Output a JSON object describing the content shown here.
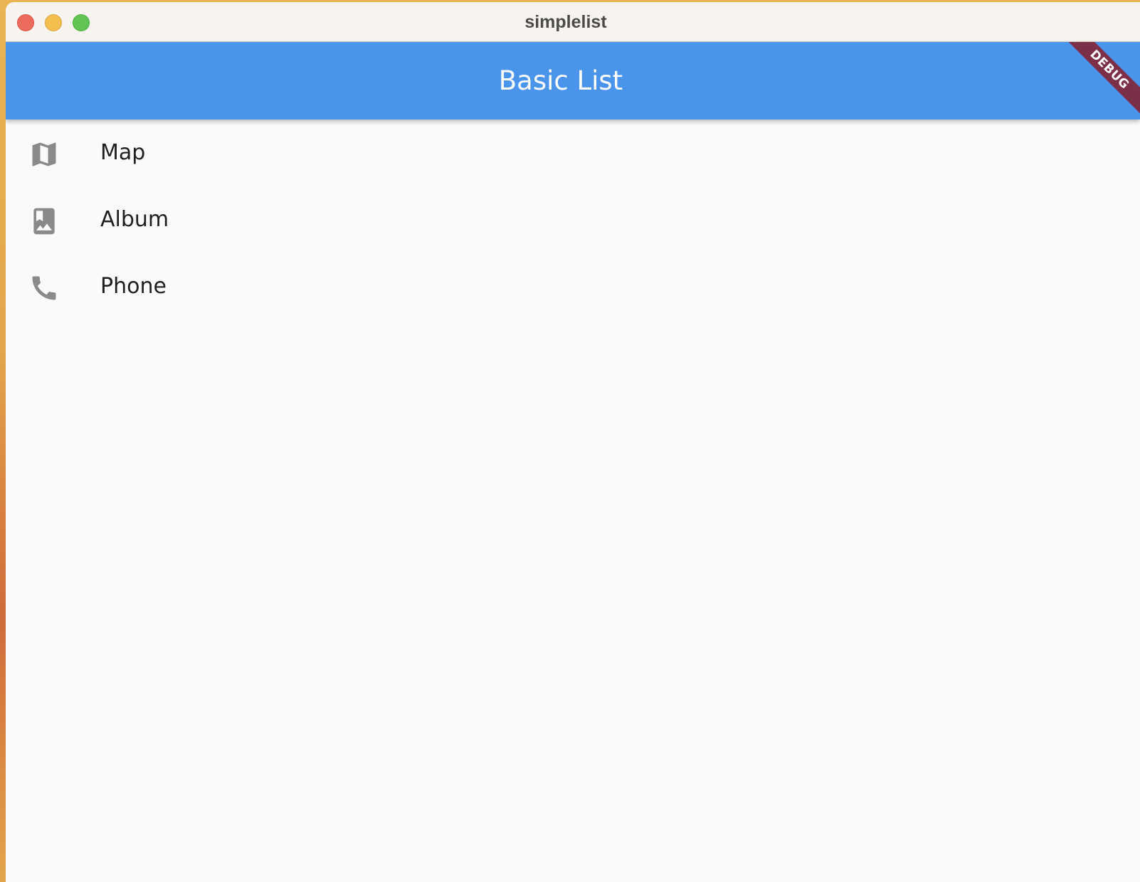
{
  "window": {
    "title": "simplelist"
  },
  "appbar": {
    "title": "Basic List",
    "color": "#4a94ec",
    "debug_banner": "DEBUG"
  },
  "list": {
    "items": [
      {
        "label": "Map",
        "icon": "map-icon"
      },
      {
        "label": "Album",
        "icon": "photo-album-icon"
      },
      {
        "label": "Phone",
        "icon": "phone-icon"
      }
    ]
  }
}
